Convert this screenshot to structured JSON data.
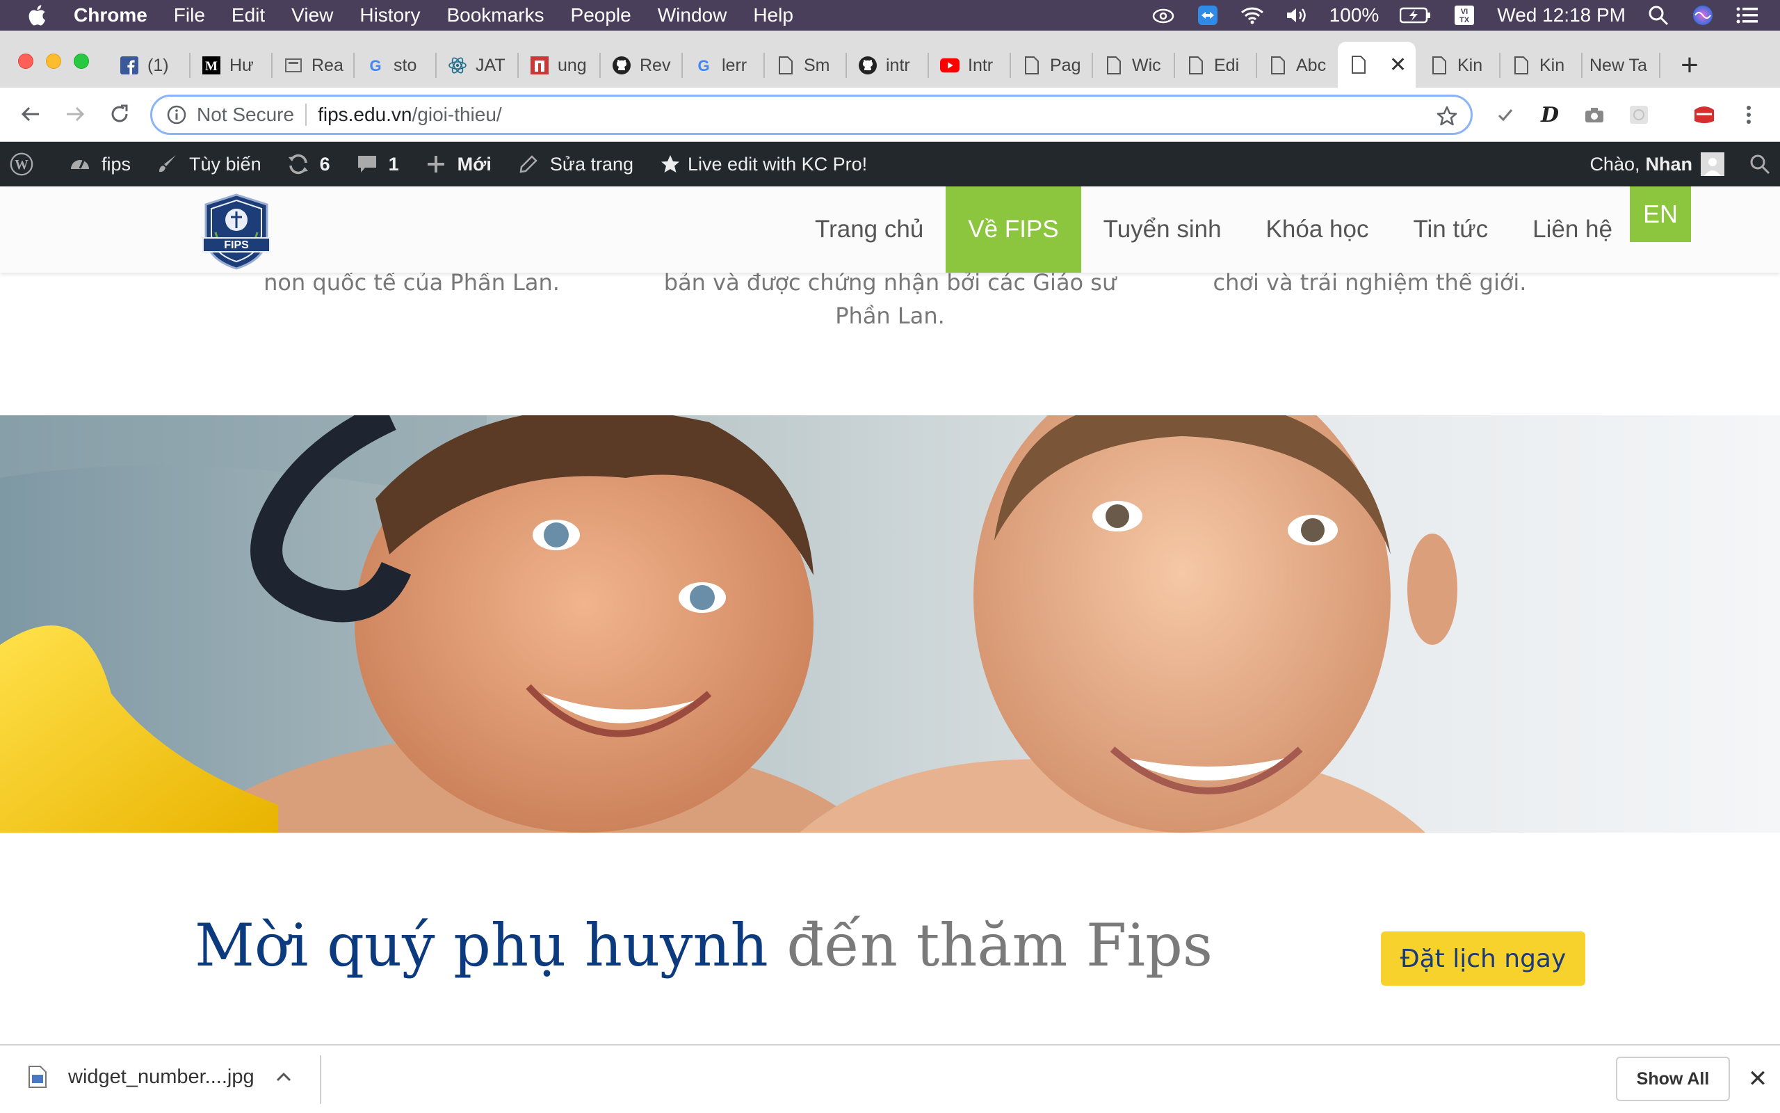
{
  "menubar": {
    "app": "Chrome",
    "items": [
      "File",
      "Edit",
      "View",
      "History",
      "Bookmarks",
      "People",
      "Window",
      "Help"
    ],
    "battery": "100%",
    "clock": "Wed 12:18 PM"
  },
  "tabs": [
    {
      "label": "(1)",
      "icon": "facebook-icon"
    },
    {
      "label": "Hư",
      "icon": "medium-icon"
    },
    {
      "label": "Rea",
      "icon": "page-icon"
    },
    {
      "label": "sto",
      "icon": "google-icon"
    },
    {
      "label": "JAT",
      "icon": "react-icon"
    },
    {
      "label": "ung",
      "icon": "npm-icon"
    },
    {
      "label": "Rev",
      "icon": "github-icon"
    },
    {
      "label": "lerr",
      "icon": "google-icon"
    },
    {
      "label": "Sm",
      "icon": "page-icon"
    },
    {
      "label": "intr",
      "icon": "github-icon"
    },
    {
      "label": "Intr",
      "icon": "youtube-icon"
    },
    {
      "label": "Pag",
      "icon": "page-icon"
    },
    {
      "label": "Wic",
      "icon": "page-icon"
    },
    {
      "label": "Edi",
      "icon": "page-icon"
    },
    {
      "label": "Abc",
      "icon": "page-icon"
    },
    {
      "label": "",
      "icon": "page-icon",
      "active": true
    },
    {
      "label": "Kin",
      "icon": "page-icon"
    },
    {
      "label": "Kin",
      "icon": "page-icon"
    },
    {
      "label": "New Ta",
      "icon": ""
    }
  ],
  "omnibox": {
    "security": "Not Secure",
    "host": "fips.edu.vn",
    "path": "/gioi-thieu/"
  },
  "wpbar": {
    "site": "fips",
    "customize": "Tùy biến",
    "updates": "6",
    "comments": "1",
    "new": "Mới",
    "edit_page": "Sửa trang",
    "live_edit": "Live edit with KC Pro!",
    "greeting": "Chào,",
    "user": "Nhan"
  },
  "site": {
    "logo_text": "FIPS",
    "nav": [
      "Trang chủ",
      "Về FIPS",
      "Tuyển sinh",
      "Khóa học",
      "Tin tức",
      "Liên hệ"
    ],
    "active_nav": 1,
    "lang": "EN"
  },
  "features": {
    "col1": "non quốc tế của Phần Lan.",
    "col2_line1": "bản và được chứng nhận bởi các Giáo sư",
    "col2_line2": "Phần Lan.",
    "col3": "chơi và trải nghiệm thế giới."
  },
  "cta": {
    "title_strong": "Mời quý phụ huynh",
    "title_light": "đến thăm Fips",
    "button": "Đặt lịch ngay"
  },
  "download": {
    "file": "widget_number....jpg",
    "show_all": "Show All"
  },
  "colors": {
    "accent_green": "#8cc63f",
    "cta_yellow": "#f7d22d",
    "title_blue": "#0b3a7e",
    "wp_bar": "#23282d"
  }
}
